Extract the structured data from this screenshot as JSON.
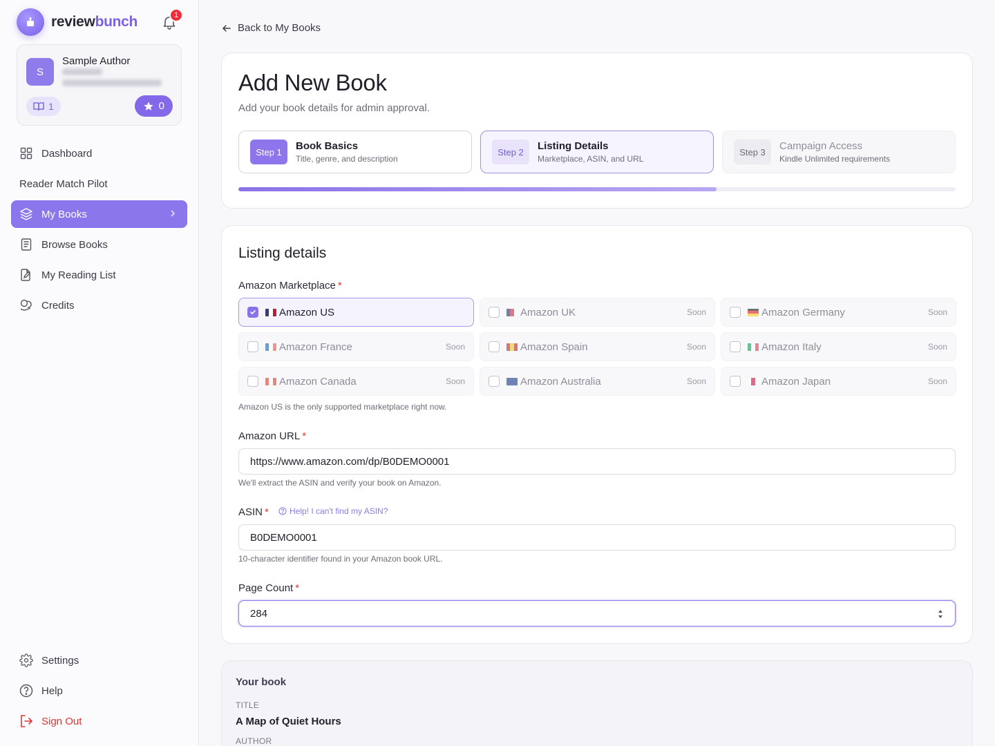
{
  "brand": {
    "name_part1": "review",
    "name_part2": "bunch",
    "accent": "#7d5fe8"
  },
  "notifications": {
    "count": "1"
  },
  "profile": {
    "initial": "S",
    "name": "Sample Author",
    "books_count": "1",
    "stars_count": "0"
  },
  "nav": {
    "dashboard": "Dashboard",
    "reader_match": "Reader Match Pilot",
    "my_books": "My Books",
    "browse_books": "Browse Books",
    "reading_list": "My Reading List",
    "credits": "Credits",
    "settings": "Settings",
    "help": "Help",
    "sign_out": "Sign Out"
  },
  "back_link": "Back to My Books",
  "header": {
    "title": "Add New Book",
    "subtitle": "Add your book details for admin approval."
  },
  "steps": [
    {
      "badge": "Step 1",
      "title": "Book Basics",
      "desc": "Title, genre, and description"
    },
    {
      "badge": "Step 2",
      "title": "Listing Details",
      "desc": "Marketplace, ASIN, and URL"
    },
    {
      "badge": "Step 3",
      "title": "Campaign Access",
      "desc": "Kindle Unlimited requirements"
    }
  ],
  "progress_fraction": 0.667,
  "listing": {
    "section_title": "Listing details",
    "marketplace_label": "Amazon Marketplace",
    "required_mark": "*",
    "soon": "Soon",
    "marketplaces": [
      {
        "name": "Amazon US",
        "selected": true,
        "soon": false
      },
      {
        "name": "Amazon UK",
        "selected": false,
        "soon": true
      },
      {
        "name": "Amazon Germany",
        "selected": false,
        "soon": true
      },
      {
        "name": "Amazon France",
        "selected": false,
        "soon": true
      },
      {
        "name": "Amazon Spain",
        "selected": false,
        "soon": true
      },
      {
        "name": "Amazon Italy",
        "selected": false,
        "soon": true
      },
      {
        "name": "Amazon Canada",
        "selected": false,
        "soon": true
      },
      {
        "name": "Amazon Australia",
        "selected": false,
        "soon": true
      },
      {
        "name": "Amazon Japan",
        "selected": false,
        "soon": true
      }
    ],
    "marketplace_hint": "Amazon US is the only supported marketplace right now.",
    "url_label": "Amazon URL",
    "url_value": "https://www.amazon.com/dp/B0DEMO0001",
    "url_hint": "We'll extract the ASIN and verify your book on Amazon.",
    "asin_label": "ASIN",
    "asin_help": "Help! I can't find my ASIN?",
    "asin_value": "B0DEMO0001",
    "asin_hint": "10-character identifier found in your Amazon book URL.",
    "page_count_label": "Page Count",
    "page_count_value": "284"
  },
  "your_book": {
    "title": "Your book",
    "title_label": "TITLE",
    "title_value": "A Map of Quiet Hours",
    "author_label": "AUTHOR"
  }
}
